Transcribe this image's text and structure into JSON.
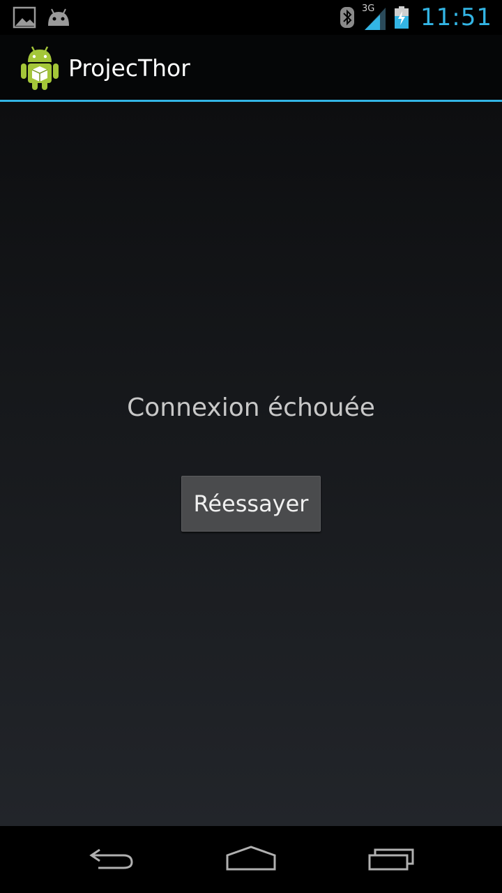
{
  "status_bar": {
    "network_type": "3G",
    "time": "11:51",
    "accent_color": "#33b5e5",
    "icons": [
      "gallery-icon",
      "android-notification-icon",
      "bluetooth-icon",
      "signal-icon",
      "battery-charging-icon"
    ]
  },
  "action_bar": {
    "title": "ProjecThor",
    "icon": "android-app-icon",
    "divider_color": "#33b5e5"
  },
  "content": {
    "message": "Connexion échouée",
    "retry_button_label": "Réessayer"
  },
  "nav_bar": {
    "buttons": [
      "back-icon",
      "home-icon",
      "recent-apps-icon"
    ]
  }
}
